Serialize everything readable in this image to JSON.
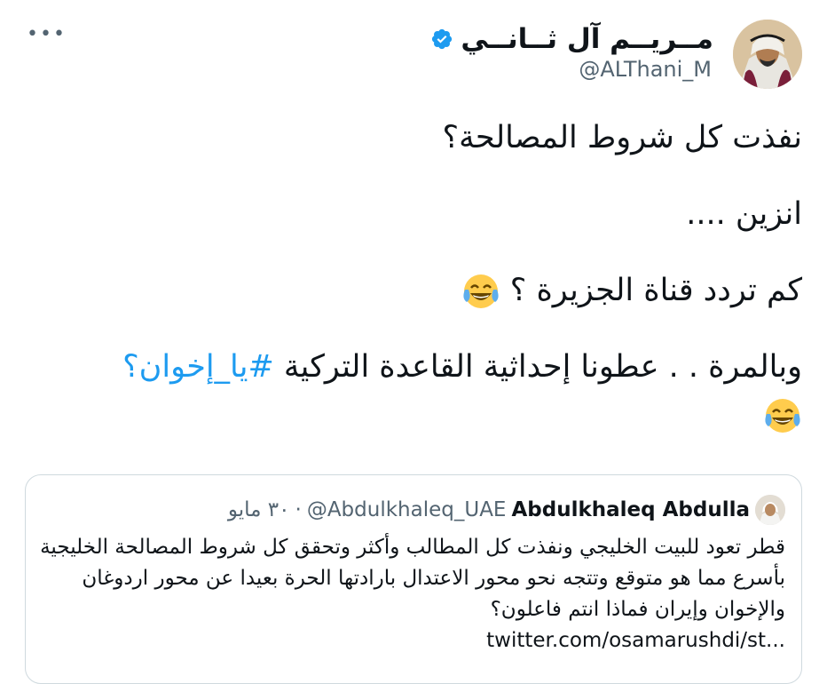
{
  "tweet": {
    "more_label": "•••",
    "author": {
      "name": "مــريــم آل ثــانــي",
      "handle": "@ALThani_M",
      "verified": true
    },
    "lines": [
      "نفذت كل شروط المصالحة؟",
      "انزين ....",
      "كم تردد قناة الجزيرة ؟",
      "وبالمرة . . عطونا إحداثية القاعدة التركية "
    ],
    "hashtag": "#يا_إخوان؟",
    "emoji_name": "face-with-tears-of-joy"
  },
  "quote": {
    "name": "Abdulkhaleq Abdulla",
    "handle": "@Abdulkhaleq_UAE",
    "separator": "·",
    "date": "٣٠ مايو",
    "body": "قطر تعود للبيت الخليجي ونفذت كل المطالب وأكثر وتحقق كل شروط المصالحة الخليجية بأسرع مما هو متوقع وتتجه نحو محور الاعتدال بارادتها الحرة بعيدا عن محور اردوغان والإخوان وإيران فماذا انتم فاعلون؟",
    "link": "twitter.com/osamarushdi/st..."
  },
  "colors": {
    "link": "#1d9bf0",
    "secondary_text": "#536471",
    "border": "#cfd9de"
  }
}
